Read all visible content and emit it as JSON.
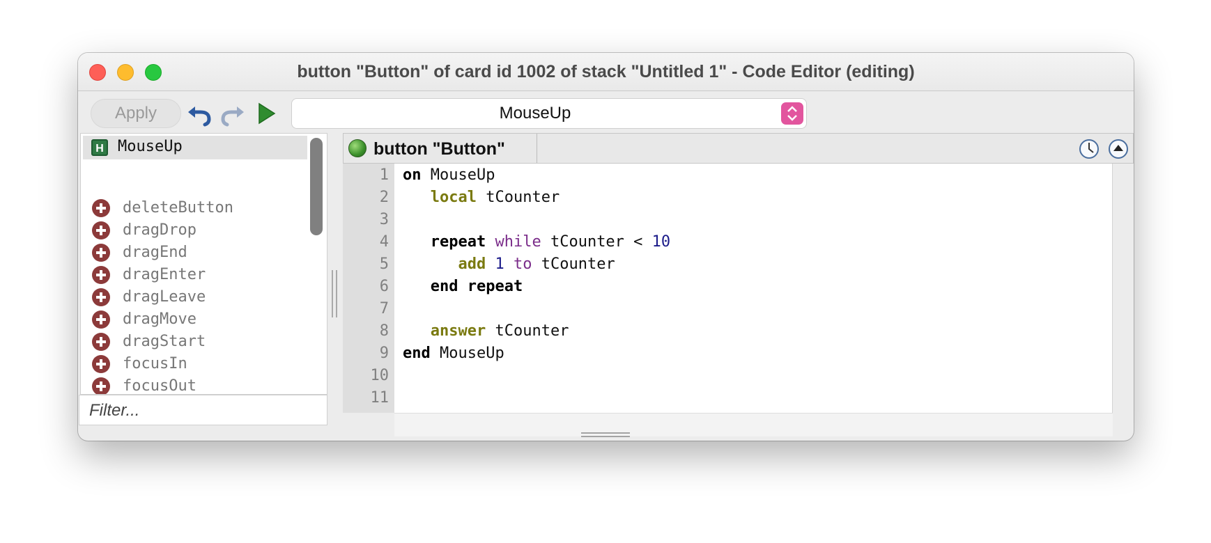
{
  "window": {
    "title": "button \"Button\" of card id 1002 of stack \"Untitled 1\" - Code Editor (editing)"
  },
  "toolbar": {
    "apply_label": "Apply",
    "handler_select_value": "MouseUp"
  },
  "handler_list": {
    "selected": {
      "icon": "H",
      "label": "MouseUp"
    },
    "messages": [
      "deleteButton",
      "dragDrop",
      "dragEnd",
      "dragEnter",
      "dragLeave",
      "dragMove",
      "dragStart",
      "focusIn",
      "focusOut"
    ],
    "filter_placeholder": "Filter..."
  },
  "editor": {
    "object_tab": "button \"Button\"",
    "line_numbers": [
      "1",
      "2",
      "3",
      "4",
      "5",
      "6",
      "7",
      "8",
      "9",
      "10",
      "11"
    ]
  },
  "colors": {
    "keyword_olive": "#7a7a10",
    "keyword_purple": "#7b2d8a",
    "number_navy": "#1b1b8a",
    "stepper_pink": "#e2559e"
  },
  "icons": [
    "undo-icon",
    "redo-icon",
    "run-icon",
    "handler-icon",
    "add-message-icon",
    "status-green-icon",
    "clock-icon",
    "eject-icon"
  ]
}
